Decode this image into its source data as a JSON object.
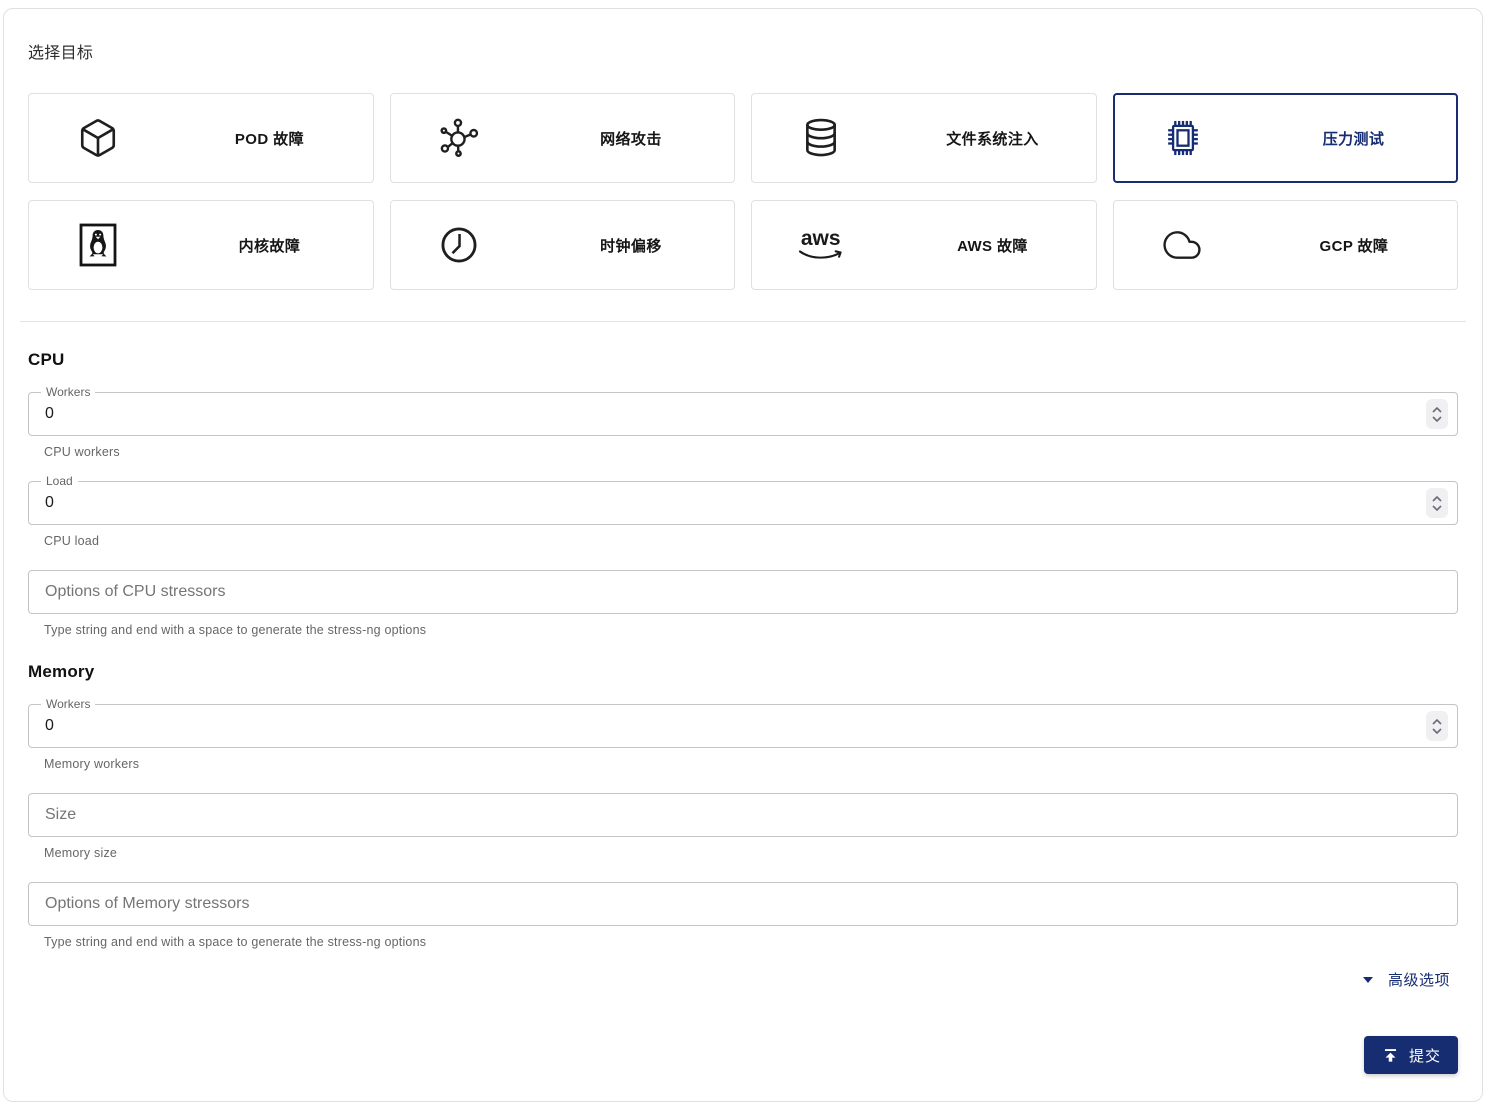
{
  "colors": {
    "accent": "#172d72",
    "card_border": "#e0e0e0",
    "input_border": "#c4c4c4",
    "helper_text": "#666666"
  },
  "target_picker": {
    "title": "选择目标",
    "targets": [
      {
        "label": "POD 故障",
        "icon": "cube-icon",
        "selected": false
      },
      {
        "label": "网络攻击",
        "icon": "network-nodes-icon",
        "selected": false
      },
      {
        "label": "文件系统注入",
        "icon": "database-icon",
        "selected": false
      },
      {
        "label": "压力测试",
        "icon": "cpu-chip-icon",
        "selected": true
      },
      {
        "label": "内核故障",
        "icon": "linux-tux-icon",
        "selected": false
      },
      {
        "label": "时钟偏移",
        "icon": "clock-icon",
        "selected": false
      },
      {
        "label": "AWS 故障",
        "icon": "aws-logo-icon",
        "selected": false
      },
      {
        "label": "GCP 故障",
        "icon": "cloud-icon",
        "selected": false
      }
    ]
  },
  "form": {
    "cpu": {
      "heading": "CPU",
      "workers": {
        "label": "Workers",
        "value": "0",
        "helper": "CPU workers"
      },
      "load": {
        "label": "Load",
        "value": "0",
        "helper": "CPU load"
      },
      "options": {
        "placeholder": "Options of CPU stressors",
        "helper": "Type string and end with a space to generate the stress-ng options"
      }
    },
    "memory": {
      "heading": "Memory",
      "workers": {
        "label": "Workers",
        "value": "0",
        "helper": "Memory workers"
      },
      "size": {
        "placeholder": "Size",
        "helper": "Memory size"
      },
      "options": {
        "placeholder": "Options of Memory stressors",
        "helper": "Type string and end with a space to generate the stress-ng options"
      }
    }
  },
  "footer": {
    "advanced_label": "高级选项",
    "submit_label": "提交"
  }
}
